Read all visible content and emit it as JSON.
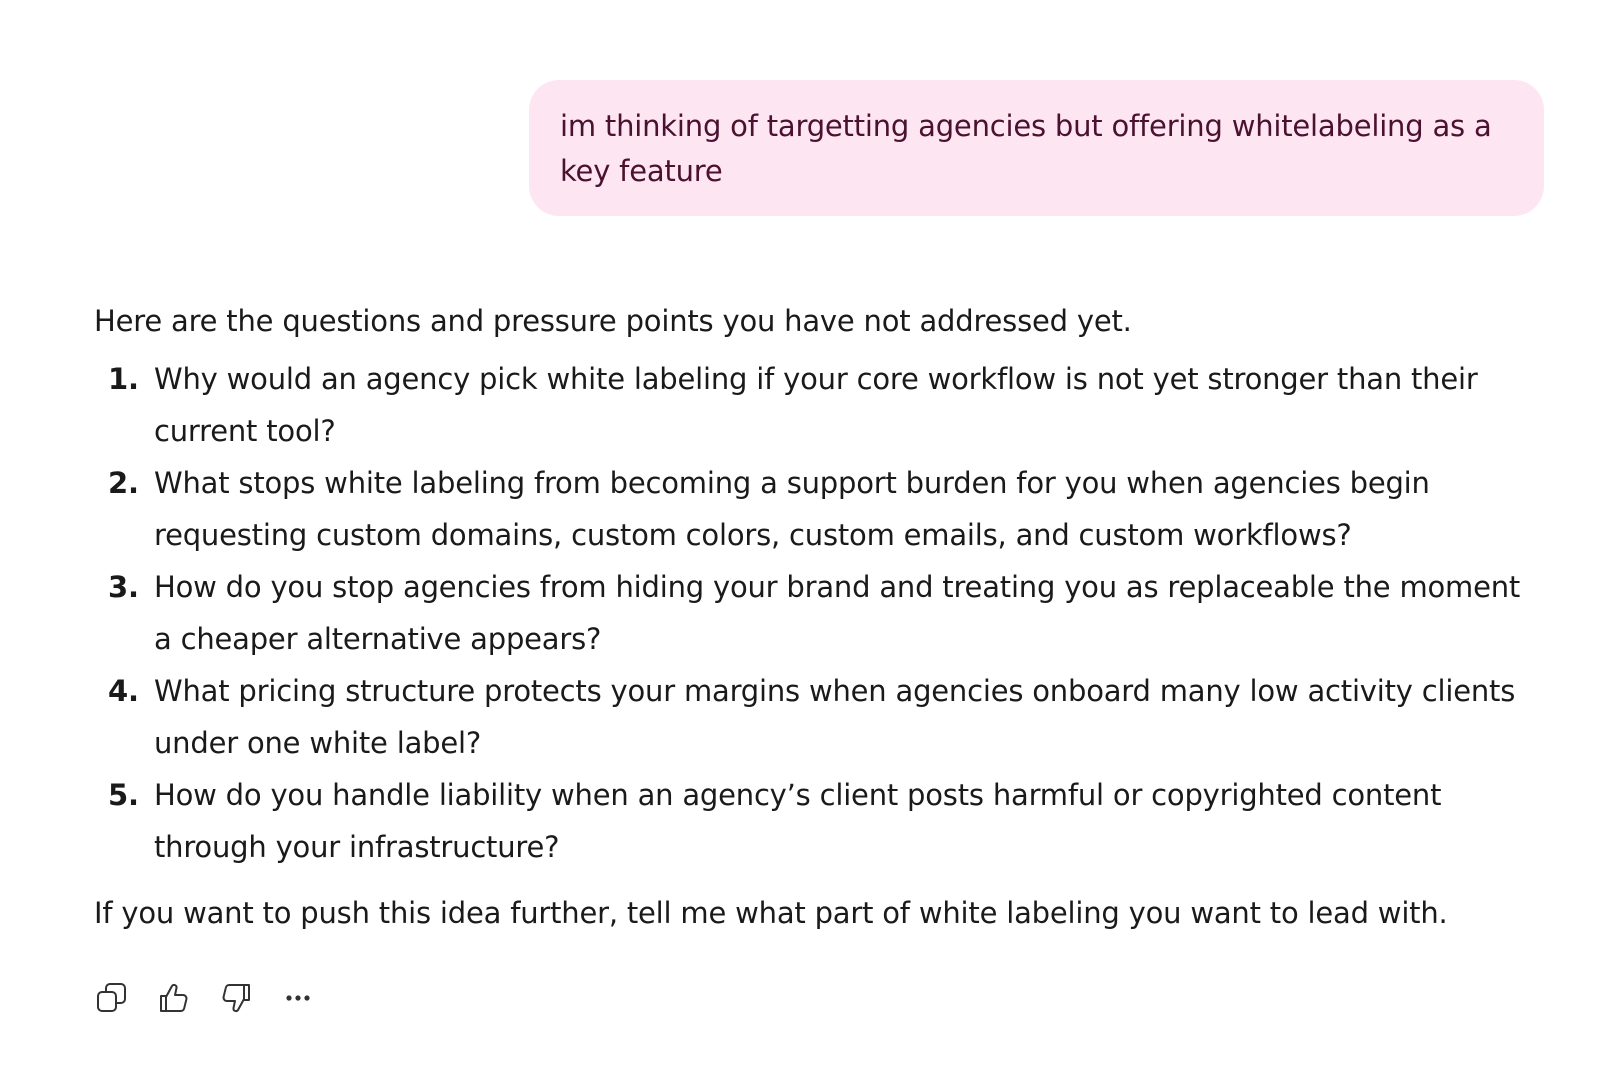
{
  "user_message": {
    "text": "im thinking of targetting agencies but offering whitelabeling as a key feature"
  },
  "assistant_response": {
    "intro": "Here are the questions and pressure points you have not addressed yet.",
    "questions": [
      {
        "num": "1.",
        "text": "Why would an agency pick white labeling if your core workflow is not yet stronger than their current tool?"
      },
      {
        "num": "2.",
        "text": "What stops white labeling from becoming a support burden for you when agencies begin requesting custom domains, custom colors, custom emails, and custom workflows?"
      },
      {
        "num": "3.",
        "text": "How do you stop agencies from hiding your brand and treating you as replaceable the moment a cheaper alternative appears?"
      },
      {
        "num": "4.",
        "text": "What pricing structure protects your margins when agencies onboard many low activity clients under one white label?"
      },
      {
        "num": "5.",
        "text": "How do you handle liability when an agency’s client posts harmful or copyrighted content through your infrastructure?"
      }
    ],
    "outro": "If you want to push this idea further, tell me what part of white labeling you want to lead with."
  },
  "actions": [
    {
      "name": "copy-icon"
    },
    {
      "name": "thumbs-up-icon"
    },
    {
      "name": "thumbs-down-icon"
    },
    {
      "name": "more-options-icon"
    }
  ],
  "colors": {
    "user_bubble_bg": "#fde5f1",
    "user_bubble_text": "#4a1230",
    "body_text": "#1a1a1a"
  }
}
